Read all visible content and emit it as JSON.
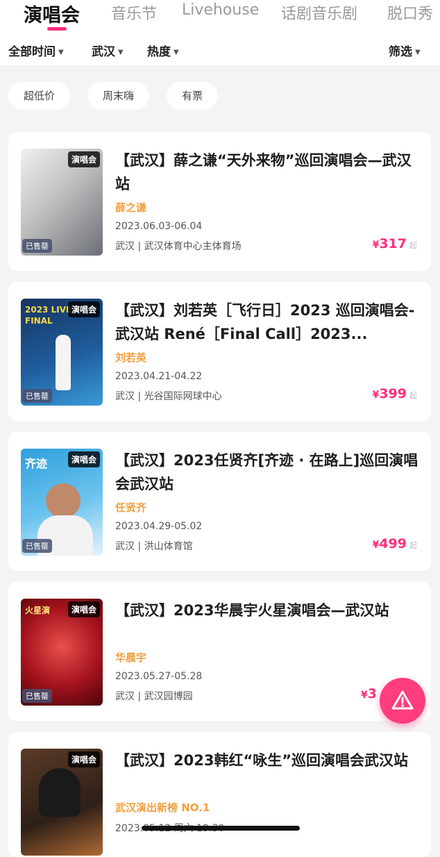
{
  "tabs": [
    "演唱会",
    "音乐节",
    "Livehouse",
    "话剧音乐剧",
    "脱口秀"
  ],
  "filters": {
    "time": "全部时间",
    "city": "武汉",
    "sort": "热度",
    "filter": "筛选"
  },
  "chips": [
    "超低价",
    "周末嗨",
    "有票"
  ],
  "cards": [
    {
      "title": "【武汉】薛之谦“天外来物”巡回演唱会—武汉站",
      "artist": "薛之谦",
      "date": "2023.06.03-06.04",
      "venue": "武汉 | 武汉体育中心主体育场",
      "price": "317",
      "price_symbol": "¥",
      "price_suffix": "起",
      "badge": "演唱会",
      "sold": "已售罄",
      "poster_text": "",
      "poster_colors": [
        "#d9d9d9",
        "#8a8f96"
      ]
    },
    {
      "title": "【武汉】刘若英［飞行日］2023 巡回演唱会-武汉站 René［Final Call］2023...",
      "artist": "刘若英",
      "date": "2023.04.21-04.22",
      "venue": "武汉 | 光谷国际网球中心",
      "price": "399",
      "price_symbol": "¥",
      "price_suffix": "起",
      "badge": "演唱会",
      "sold": "已售罄",
      "poster_text": "2023 LIVE FINAL",
      "poster_colors": [
        "#1f4f8a",
        "#2a7fbf"
      ]
    },
    {
      "title": "【武汉】2023任贤齐[齐迹 · 在路上]巡回演唱会武汉站",
      "artist": "任贤齐",
      "date": "2023.04.29-05.02",
      "venue": "武汉 | 洪山体育馆",
      "price": "499",
      "price_symbol": "¥",
      "price_suffix": "起",
      "badge": "演唱会",
      "sold": "已售罄",
      "poster_text": "齐迹",
      "poster_colors": [
        "#3aa7e0",
        "#bfe6f7"
      ]
    },
    {
      "title": "【武汉】2023华晨宇火星演唱会—武汉站",
      "artist": "华晨宇",
      "date": "2023.05.27-05.28",
      "venue": "武汉 | 武汉园博园",
      "price": "3",
      "price_symbol": "¥",
      "price_suffix": "",
      "badge": "演唱会",
      "sold": "已售罄",
      "poster_text": "火星演",
      "poster_colors": [
        "#7a0d14",
        "#c8202c"
      ]
    },
    {
      "title": "【武汉】2023韩红“咏生”巡回演唱会武汉站",
      "artist": "武汉演出新榜 NO.1",
      "date": "2023.05.12 周六 19:30",
      "venue": "",
      "price": "",
      "price_symbol": "",
      "price_suffix": "",
      "badge": "演唱会",
      "sold": "",
      "poster_text": "",
      "poster_colors": [
        "#3a2a20",
        "#a0623a"
      ]
    }
  ],
  "colors": {
    "accent": "#ff2e7e",
    "artist": "#f0a040",
    "fab": "#ff3d7f"
  },
  "fab_icon": "alert-triangle-icon"
}
